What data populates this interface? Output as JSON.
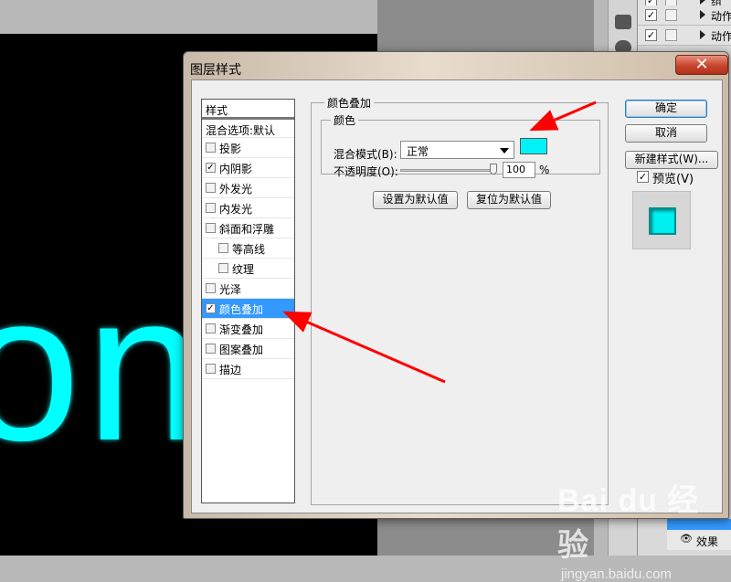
{
  "background": {
    "canvas_text": "one",
    "layers": [
      {
        "label": "组",
        "checked": true
      },
      {
        "label": "动作",
        "checked": true
      },
      {
        "label": "动作",
        "checked": true
      }
    ],
    "effects_label": "效果"
  },
  "dialog": {
    "title": "图层样式",
    "close_glyph": "✕",
    "styles_header": "样式",
    "blend_options_label": "混合选项:默认",
    "styles": [
      {
        "label": "投影",
        "checked": false,
        "indent": false
      },
      {
        "label": "内阴影",
        "checked": true,
        "indent": false
      },
      {
        "label": "外发光",
        "checked": false,
        "indent": false
      },
      {
        "label": "内发光",
        "checked": false,
        "indent": false
      },
      {
        "label": "斜面和浮雕",
        "checked": false,
        "indent": false
      },
      {
        "label": "等高线",
        "checked": false,
        "indent": true
      },
      {
        "label": "纹理",
        "checked": false,
        "indent": true
      },
      {
        "label": "光泽",
        "checked": false,
        "indent": false
      },
      {
        "label": "颜色叠加",
        "checked": true,
        "indent": false,
        "selected": true
      },
      {
        "label": "渐变叠加",
        "checked": false,
        "indent": false
      },
      {
        "label": "图案叠加",
        "checked": false,
        "indent": false
      },
      {
        "label": "描边",
        "checked": false,
        "indent": false
      }
    ],
    "panel": {
      "group_title": "颜色叠加",
      "subgroup_title": "颜色",
      "blend_mode_label": "混合模式(B):",
      "blend_mode_value": "正常",
      "overlay_color": "#00f2f7",
      "opacity_label": "不透明度(O):",
      "opacity_value": "100",
      "opacity_unit": "%",
      "set_default_label": "设置为默认值",
      "reset_default_label": "复位为默认值"
    },
    "buttons": {
      "ok": "确定",
      "cancel": "取消",
      "new_style": "新建样式(W)...",
      "preview_label": "预览(V)",
      "preview_checked": true
    }
  },
  "watermark": {
    "brand": "Bai du 经验",
    "url": "jingyan.baidu.com"
  },
  "colors": {
    "accent": "#3399ff",
    "cyan": "#00ffff",
    "annotation_arrow": "#ff0000"
  }
}
